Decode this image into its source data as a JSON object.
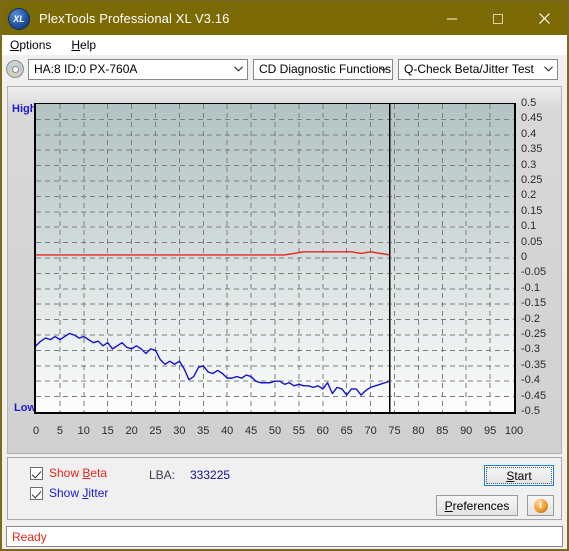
{
  "window": {
    "title": "PlexTools Professional XL V3.16",
    "icon_label": "XL",
    "minimize_label": "Minimize",
    "maximize_label": "Maximize",
    "close_label": "Close",
    "titlebar_color": "#7c6a06"
  },
  "menu": {
    "items": [
      {
        "label": "Options",
        "accel": "O"
      },
      {
        "label": "Help",
        "accel": "H"
      }
    ]
  },
  "toolbar": {
    "drive_combo": "HA:8 ID:0  PX-760A",
    "function_combo": "CD Diagnostic Functions",
    "test_combo": "Q-Check Beta/Jitter Test"
  },
  "controls": {
    "show_beta_label": "Show Beta",
    "show_jitter_label": "Show Jitter",
    "show_beta_checked": true,
    "show_jitter_checked": true,
    "lba_label": "LBA:",
    "lba_value": "333225",
    "start_label": "Start",
    "preferences_label": "Preferences",
    "info_glyph": "i"
  },
  "status": {
    "text": "Ready"
  },
  "chart_data": {
    "type": "line",
    "title": "Q-Check Beta/Jitter Test",
    "xlabel": "",
    "ylabel": "",
    "xlim": [
      0,
      100
    ],
    "ylim": [
      -0.5,
      0.5
    ],
    "grid": true,
    "legend": "none",
    "left_axis_top_label": "High",
    "left_axis_bottom_label": "Low",
    "x_ticks": [
      0,
      5,
      10,
      15,
      20,
      25,
      30,
      35,
      40,
      45,
      50,
      55,
      60,
      65,
      70,
      75,
      80,
      85,
      90,
      95,
      100
    ],
    "y_ticks": [
      0.5,
      0.45,
      0.4,
      0.35,
      0.3,
      0.25,
      0.2,
      0.15,
      0.1,
      0.05,
      0,
      -0.05,
      -0.1,
      -0.15,
      -0.2,
      -0.25,
      -0.3,
      -0.35,
      -0.4,
      -0.45,
      -0.5
    ],
    "y_tick_labels": [
      "0.5",
      "0.45",
      "0.4",
      "0.35",
      "0.3",
      "0.25",
      "0.2",
      "0.15",
      "0.1",
      "0.05",
      "0",
      "-0.05",
      "-0.1",
      "-0.15",
      "-0.2",
      "-0.25",
      "-0.3",
      "-0.35",
      "-0.4",
      "-0.45",
      "-0.5"
    ],
    "data_end_x": 74,
    "marker_line_x": 74,
    "series": [
      {
        "name": "Beta",
        "color": "#e8241c",
        "x": [
          0,
          2,
          4,
          6,
          8,
          10,
          12,
          14,
          16,
          18,
          20,
          22,
          24,
          26,
          28,
          30,
          32,
          34,
          36,
          38,
          40,
          42,
          44,
          46,
          48,
          50,
          52,
          54,
          56,
          58,
          60,
          62,
          64,
          66,
          68,
          70,
          72,
          74
        ],
        "values": [
          0.01,
          0.01,
          0.01,
          0.01,
          0.01,
          0.01,
          0.01,
          0.01,
          0.01,
          0.01,
          0.01,
          0.01,
          0.01,
          0.01,
          0.01,
          0.01,
          0.01,
          0.01,
          0.01,
          0.01,
          0.01,
          0.01,
          0.01,
          0.01,
          0.01,
          0.01,
          0.01,
          0.015,
          0.02,
          0.02,
          0.02,
          0.02,
          0.02,
          0.02,
          0.015,
          0.02,
          0.015,
          0.01
        ]
      },
      {
        "name": "Jitter",
        "color": "#1414c8",
        "x": [
          0,
          1,
          2,
          3,
          4,
          5,
          6,
          7,
          8,
          9,
          10,
          11,
          12,
          13,
          14,
          15,
          16,
          17,
          18,
          19,
          20,
          21,
          22,
          23,
          24,
          25,
          26,
          27,
          28,
          29,
          30,
          31,
          32,
          33,
          34,
          35,
          36,
          37,
          38,
          39,
          40,
          41,
          42,
          43,
          44,
          45,
          46,
          47,
          48,
          49,
          50,
          51,
          52,
          53,
          54,
          55,
          56,
          57,
          58,
          59,
          60,
          61,
          62,
          63,
          64,
          65,
          66,
          67,
          68,
          69,
          70,
          71,
          72,
          73,
          74
        ],
        "values": [
          -0.285,
          -0.27,
          -0.26,
          -0.265,
          -0.255,
          -0.265,
          -0.255,
          -0.245,
          -0.25,
          -0.26,
          -0.255,
          -0.265,
          -0.275,
          -0.27,
          -0.285,
          -0.275,
          -0.295,
          -0.285,
          -0.275,
          -0.29,
          -0.295,
          -0.285,
          -0.295,
          -0.31,
          -0.295,
          -0.3,
          -0.33,
          -0.345,
          -0.335,
          -0.345,
          -0.335,
          -0.36,
          -0.395,
          -0.385,
          -0.355,
          -0.35,
          -0.37,
          -0.375,
          -0.365,
          -0.375,
          -0.39,
          -0.39,
          -0.385,
          -0.39,
          -0.38,
          -0.385,
          -0.4,
          -0.405,
          -0.405,
          -0.405,
          -0.4,
          -0.4,
          -0.41,
          -0.405,
          -0.415,
          -0.41,
          -0.415,
          -0.415,
          -0.42,
          -0.415,
          -0.425,
          -0.405,
          -0.44,
          -0.42,
          -0.425,
          -0.445,
          -0.425,
          -0.425,
          -0.445,
          -0.43,
          -0.42,
          -0.415,
          -0.41,
          -0.405,
          -0.4
        ]
      }
    ]
  }
}
